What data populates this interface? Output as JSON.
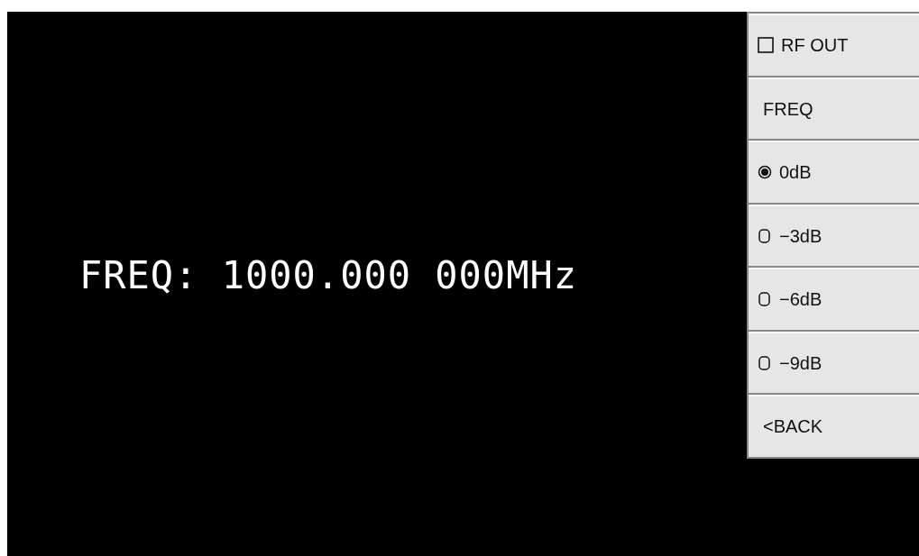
{
  "display": {
    "frequency": "FREQ: 1000.000 000MHz"
  },
  "menu": [
    {
      "kind": "checkbox",
      "label": "RF OUT",
      "checked": false
    },
    {
      "kind": "label",
      "label": "FREQ"
    },
    {
      "kind": "radio",
      "label": "0dB",
      "selected": true
    },
    {
      "kind": "radio",
      "label": "−3dB",
      "selected": false
    },
    {
      "kind": "radio",
      "label": "−6dB",
      "selected": false
    },
    {
      "kind": "radio",
      "label": "−9dB",
      "selected": false
    },
    {
      "kind": "label",
      "label": "<BACK"
    }
  ]
}
